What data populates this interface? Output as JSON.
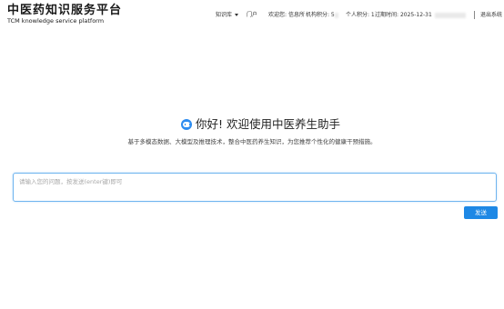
{
  "header": {
    "logo_title": "中医药知识服务平台",
    "logo_subtitle": "TCM knowledge service platform",
    "nav": {
      "knowledge_base": "知识库",
      "portal": "门户",
      "welcome_label": "欢迎您: ",
      "welcome_name": "信息所",
      "org_points_label": "机构积分: 5",
      "personal_points_label": "个人积分: 1",
      "expiry_label": "过期时间: ",
      "expiry_date": "2025-12-31",
      "logout": "退出系统"
    }
  },
  "main": {
    "title": "你好! 欢迎使用中医养生助手",
    "subtitle": "基于多模态数据、大模型及推理技术，整合中医药养生知识，为您推荐个性化的健康干预措施。",
    "input_placeholder": "请输入您的问题，按发送(enter键)即可",
    "input_value": "",
    "send_label": "发送"
  },
  "colors": {
    "accent": "#1e88e5",
    "input_border": "#6fb4ee",
    "icon": "#2d8cf0"
  },
  "icons": {
    "caret": "chevron-down-icon",
    "assistant": "robot-assistant-icon"
  }
}
